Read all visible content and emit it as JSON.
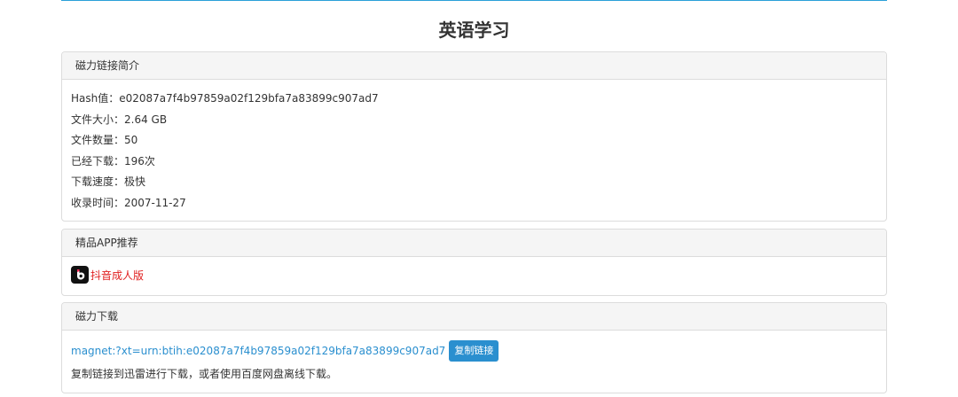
{
  "page": {
    "title": "英语学习"
  },
  "info_panel": {
    "heading": "磁力链接简介",
    "lines": [
      "Hash值：e02087a7f4b97859a02f129bfa7a83899c907ad7",
      "文件大小：2.64 GB",
      "文件数量：50",
      "已经下载：196次",
      "下载速度：极快",
      "收录时间：2007-11-27"
    ]
  },
  "app_panel": {
    "heading": "精品APP推荐",
    "app_label": "抖音成人版",
    "icon": "app-logo-icon"
  },
  "magnet_panel": {
    "heading": "磁力下载",
    "link": "magnet:?xt=urn:btih:e02087a7f4b97859a02f129bfa7a83899c907ad7",
    "copy_button": "复制链接",
    "hint": "复制链接到迅雷进行下载，或者使用百度网盘离线下载。"
  },
  "colors": {
    "accent": "#2a8fcf",
    "app_link": "#e02020",
    "top_rule": "#2aa0d8"
  }
}
